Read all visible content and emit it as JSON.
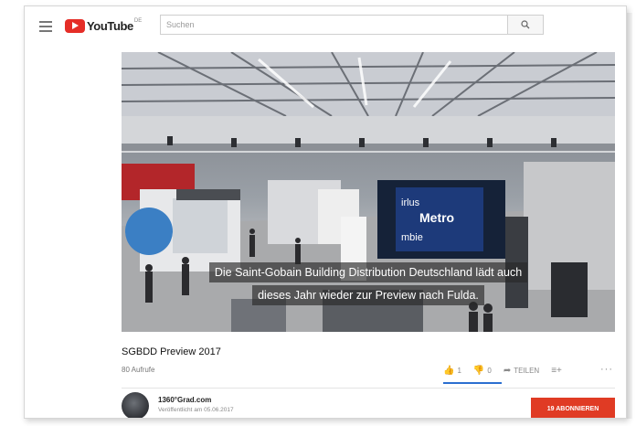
{
  "header": {
    "logo_text": "YouTube",
    "logo_region": "DE",
    "search": {
      "placeholder": "Suchen",
      "value": ""
    }
  },
  "video": {
    "caption_line1": "Die Saint-Gobain Building Distribution Deutschland lädt auch",
    "caption_line2": "dieses Jahr wieder zur Preview nach Fulda.",
    "scene_sign_line1": "irlus",
    "scene_sign_line2": "Metro",
    "scene_sign_line3": "mbie"
  },
  "info": {
    "title": "SGBDD Preview 2017",
    "views": "80 Aufrufe",
    "likes": "1",
    "dislikes": "0",
    "share_label": "TEILEN",
    "like_ratio": 1.0
  },
  "channel": {
    "name": "1360°Grad.com",
    "published": "Veröffentlicht am 05.06.2017"
  },
  "subscribe": {
    "label": "19 ABONNIEREN"
  },
  "colors": {
    "brand_red": "#e52d27",
    "subscribe_red": "#e03b24",
    "like_blue": "#2b6fd0"
  }
}
